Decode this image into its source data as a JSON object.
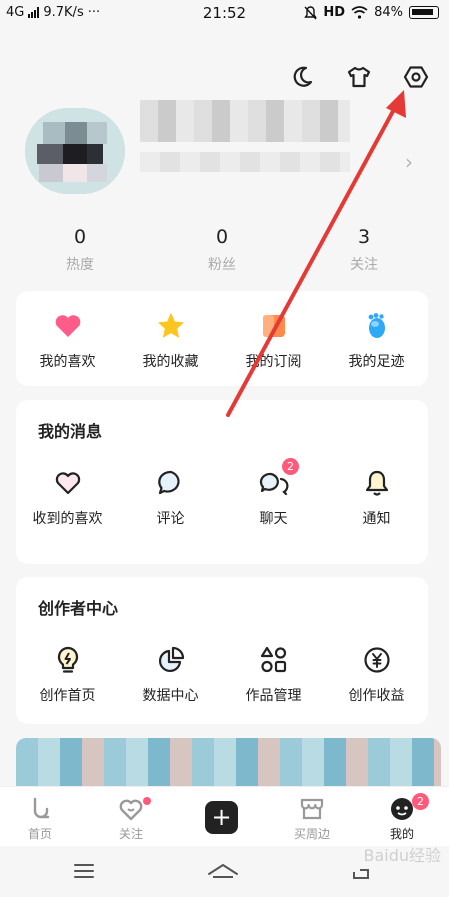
{
  "status_bar": {
    "network": "4G",
    "speed": "9.7K/s",
    "more": "···",
    "time": "21:52",
    "hd": "HD",
    "battery": "84%"
  },
  "top_icons": [
    "moon-icon",
    "tshirt-icon",
    "settings-hexagon-icon"
  ],
  "stats": [
    {
      "value": "0",
      "label": "热度"
    },
    {
      "value": "0",
      "label": "粉丝"
    },
    {
      "value": "3",
      "label": "关注"
    }
  ],
  "quick_actions": [
    {
      "label": "我的喜欢",
      "icon": "heart-icon",
      "color": "#ff5c8a"
    },
    {
      "label": "我的收藏",
      "icon": "star-icon",
      "color": "#ffc51f"
    },
    {
      "label": "我的订阅",
      "icon": "subscribe-icon",
      "color": "#ff8a4c"
    },
    {
      "label": "我的足迹",
      "icon": "footprint-icon",
      "color": "#2fa8f5"
    }
  ],
  "messages": {
    "title": "我的消息",
    "items": [
      {
        "label": "收到的喜欢",
        "icon": "heart-outline-icon"
      },
      {
        "label": "评论",
        "icon": "comment-icon"
      },
      {
        "label": "聊天",
        "icon": "chat-icon",
        "badge": "2"
      },
      {
        "label": "通知",
        "icon": "bell-icon"
      }
    ]
  },
  "creator": {
    "title": "创作者中心",
    "items": [
      {
        "label": "创作首页",
        "icon": "lightbulb-icon"
      },
      {
        "label": "数据中心",
        "icon": "pie-chart-icon"
      },
      {
        "label": "作品管理",
        "icon": "shapes-icon"
      },
      {
        "label": "创作收益",
        "icon": "yuan-icon"
      }
    ]
  },
  "tabbar": [
    {
      "label": "首页",
      "icon": "home-tab-icon"
    },
    {
      "label": "关注",
      "icon": "follow-tab-icon"
    },
    {
      "label": "",
      "icon": "plus-icon"
    },
    {
      "label": "买周边",
      "icon": "shop-tab-icon"
    },
    {
      "label": "我的",
      "icon": "me-tab-icon",
      "badge": "2",
      "active": true
    }
  ],
  "watermark": "Baidu经验",
  "colors": {
    "accent": "#ff5a7a",
    "arrow": "#e53935"
  }
}
